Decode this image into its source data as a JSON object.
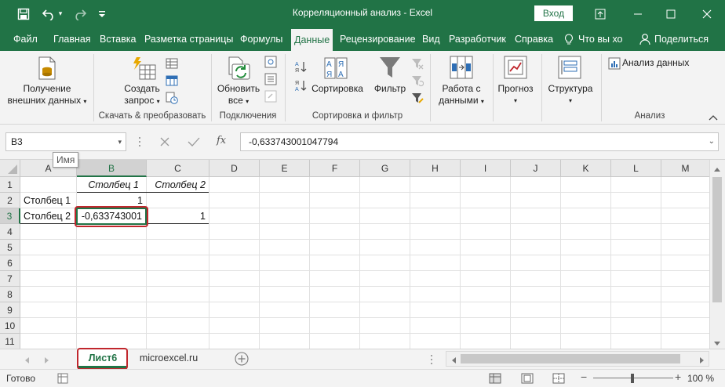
{
  "window": {
    "title": "Корреляционный анализ  -  Excel",
    "signin_label": "Вход"
  },
  "tabs": [
    "Файл",
    "Главная",
    "Вставка",
    "Разметка страницы",
    "Формулы",
    "Данные",
    "Рецензирование",
    "Вид",
    "Разработчик",
    "Справка"
  ],
  "active_tab": "Данные",
  "tell_me": "Что вы хо",
  "share_label": "Поделиться",
  "ribbon": {
    "get_data": {
      "line1": "Получение",
      "line2": "внешних данных"
    },
    "create_query": {
      "line1": "Создать",
      "line2": "запрос"
    },
    "group_get_transform": "Скачать & преобразовать",
    "refresh_all": {
      "line1": "Обновить",
      "line2": "все"
    },
    "group_connections": "Подключения",
    "sort_label": "Сортировка",
    "filter_label": "Фильтр",
    "group_sort_filter": "Сортировка и фильтр",
    "data_tools": {
      "line1": "Работа с",
      "line2": "данными"
    },
    "forecast": "Прогноз",
    "outline": "Структура",
    "data_analysis": "Анализ данных",
    "group_analysis": "Анализ",
    "sort_az_top": "А",
    "sort_az_bottom": "Я",
    "sort_za_top": "Я",
    "sort_za_bottom": "А"
  },
  "formula_bar": {
    "name_box": "B3",
    "formula": "-0,633743001047794",
    "fx": "fx",
    "tooltip": "Имя"
  },
  "grid": {
    "columns": [
      "A",
      "B",
      "C",
      "D",
      "E",
      "F",
      "G",
      "H",
      "I",
      "J",
      "K",
      "L",
      "M"
    ],
    "rows": [
      "1",
      "2",
      "3",
      "4",
      "5",
      "6",
      "7",
      "8",
      "9",
      "10",
      "11"
    ],
    "selected_col": "B",
    "selected_row": "3",
    "cells": {
      "B1": "Столбец 1",
      "C1": "Столбец 2",
      "A2": "Столбец 1",
      "B2": "1",
      "A3": "Столбец 2",
      "B3": "-0,633743001",
      "C3": "1"
    }
  },
  "sheets": {
    "active": "Лист6",
    "other": "microexcel.ru"
  },
  "status": {
    "ready": "Готово",
    "zoom": "100 %"
  },
  "colors": {
    "excel_green": "#217346",
    "highlight_red": "#c0272d"
  }
}
